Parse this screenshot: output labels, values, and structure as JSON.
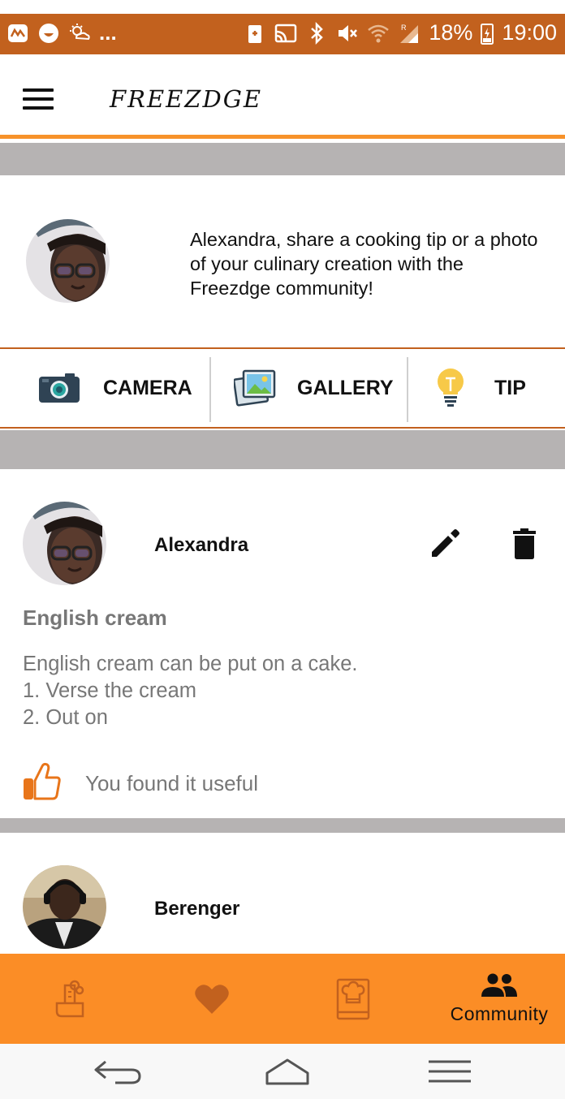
{
  "status_bar": {
    "dots": "...",
    "battery": "18%",
    "time": "19:00",
    "background": "#c2611e"
  },
  "app_bar": {
    "title": "FREEZDGE",
    "accent": "#f7922a"
  },
  "composer": {
    "prompt": "Alexandra, share a cooking tip or a photo of your culinary creation with the Freezdge community!"
  },
  "actions": {
    "camera": "CAMERA",
    "gallery": "GALLERY",
    "tip": "TIP"
  },
  "posts": [
    {
      "author": "Alexandra",
      "title": "English cream",
      "body_lines": [
        "English cream can be put on a cake.",
        "1. Verse the cream",
        "2. Out on"
      ],
      "useful_text": "You found it useful"
    },
    {
      "author": "Berenger"
    }
  ],
  "bottom_nav": {
    "active_label": "Community",
    "background": "#fb8d26"
  }
}
